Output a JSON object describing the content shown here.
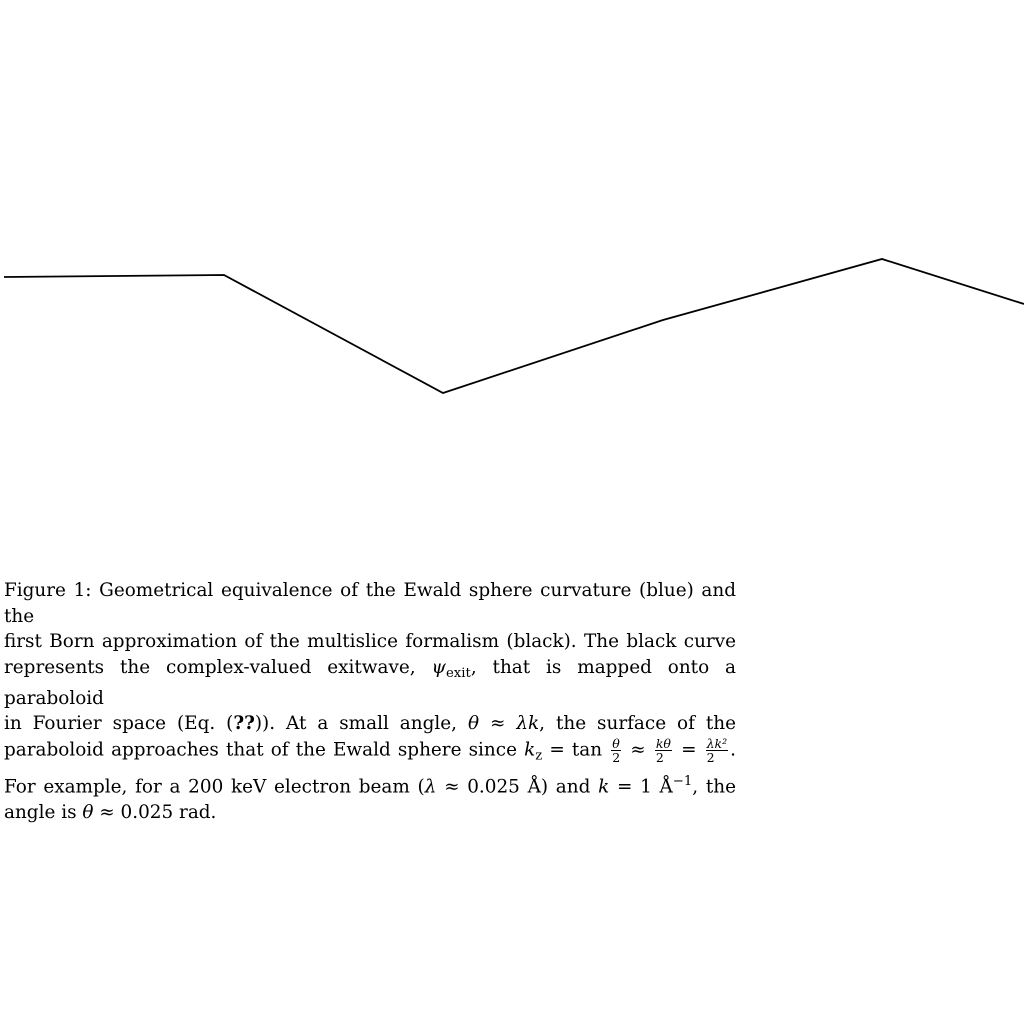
{
  "figure": {
    "curve_color": "#000000"
  },
  "caption": {
    "line1": "Figure 1: Geometrical equivalence of the Ewald sphere curvature (blue) and the",
    "line2": "first Born approximation of the multislice formalism (black). The black curve",
    "line3_a": "represents the complex-valued exitwave, ",
    "line3_psi": "ψ",
    "line3_sub": "exit",
    "line3_b": ", that is mapped onto a paraboloid",
    "line4_a": "in Fourier space (Eq. (",
    "line4_ref": "??",
    "line4_b": ")). At a small angle, ",
    "line4_theta": "θ",
    "line4_c": " ≈ ",
    "line4_lk": "λk",
    "line4_d": ", the surface of the",
    "line5_a": "paraboloid approaches that of the Ewald sphere since ",
    "line5_kz": "k",
    "line5_kz_sub": "z",
    "line5_b": " = tan ",
    "line5_f1_num": "θ",
    "line5_f1_den": "2",
    "line5_c": " ≈ ",
    "line5_f2_num": "kθ",
    "line5_f2_den": "2",
    "line5_d": " = ",
    "line5_f3_num": "λk²",
    "line5_f3_den": "2",
    "line5_e": ".",
    "line6_a": "For example, for a 200 keV electron beam (",
    "line6_lambda": "λ",
    "line6_b": " ≈ 0.025 Å) and ",
    "line6_k": "k",
    "line6_c": " = 1 Å",
    "line6_sup": "−1",
    "line6_d": ", the",
    "line7_a": "angle is ",
    "line7_theta": "θ",
    "line7_b": " ≈ 0.025 rad."
  }
}
